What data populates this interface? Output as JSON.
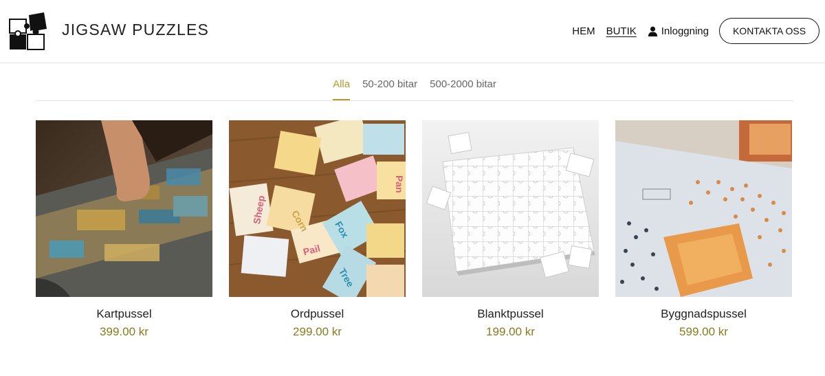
{
  "brand": {
    "name": "JIGSAW PUZZLES",
    "logo_icon": "puzzle-logo-icon"
  },
  "nav": {
    "home": "HEM",
    "shop": "BUTIK",
    "login": "Inloggning",
    "login_icon": "user-icon",
    "contact": "KONTAKTA OSS"
  },
  "filters": [
    {
      "label": "Alla",
      "active": true
    },
    {
      "label": "50-200 bitar",
      "active": false
    },
    {
      "label": "500-2000 bitar",
      "active": false
    }
  ],
  "colors": {
    "accent": "#b59a2e",
    "price": "#8a7a1c"
  },
  "products": [
    {
      "name": "Kartpussel",
      "price": "399.00 kr",
      "image": "map-puzzle-photo"
    },
    {
      "name": "Ordpussel",
      "price": "299.00 kr",
      "image": "word-puzzle-photo",
      "image_words": [
        "Sheep",
        "Corn",
        "Fox",
        "Pail",
        "Pan",
        "Tree"
      ]
    },
    {
      "name": "Blanktpussel",
      "price": "199.00 kr",
      "image": "blank-puzzle-photo"
    },
    {
      "name": "Byggnadspussel",
      "price": "599.00 kr",
      "image": "building-puzzle-photo"
    }
  ]
}
